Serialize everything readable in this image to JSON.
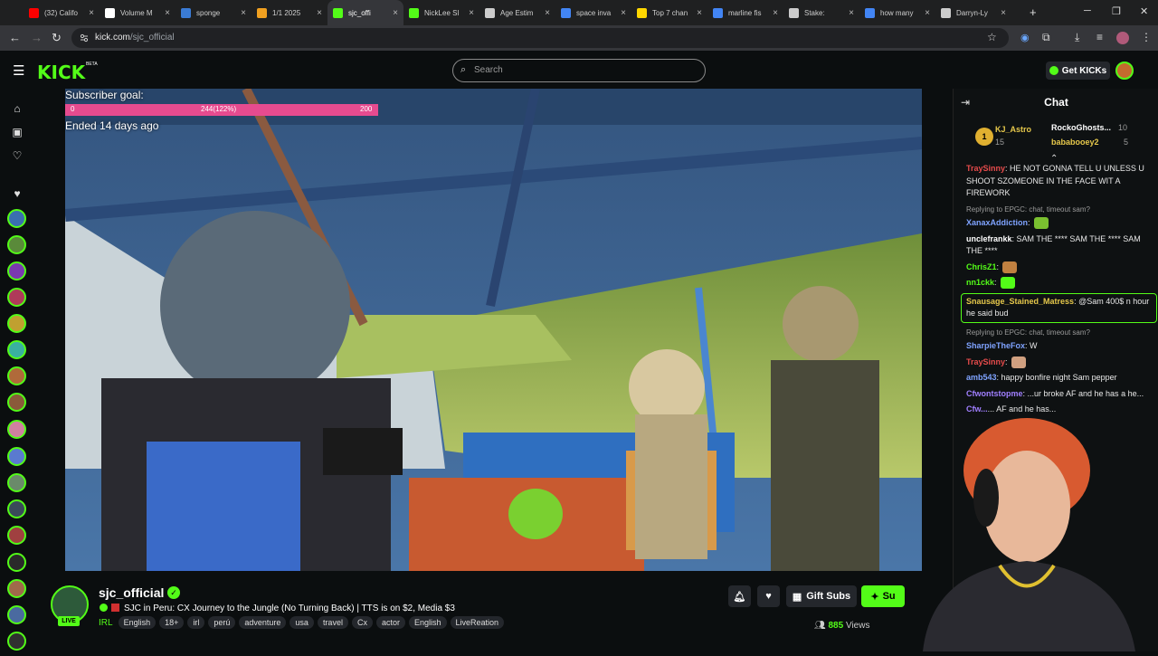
{
  "browser": {
    "tabs": [
      {
        "label": "(32) Califo",
        "color": "#ff0000"
      },
      {
        "label": "Volume M",
        "color": "#ffffff"
      },
      {
        "label": "sponge",
        "color": "#3a7bd5"
      },
      {
        "label": "1/1 2025",
        "color": "#f0a020"
      },
      {
        "label": "sjc_offi",
        "color": "#53fc18",
        "active": true
      },
      {
        "label": "NickLee Sl",
        "color": "#53fc18"
      },
      {
        "label": "Age Estim",
        "color": "#cccccc"
      },
      {
        "label": "space inva",
        "color": "#4285f4"
      },
      {
        "label": "Top 7 chan",
        "color": "#ffd700"
      },
      {
        "label": "marline fis",
        "color": "#4285f4"
      },
      {
        "label": "Stake:",
        "color": "#cccccc"
      },
      {
        "label": "how many",
        "color": "#4285f4"
      },
      {
        "label": "Darryn-Ly",
        "color": "#cccccc"
      }
    ],
    "url_host": "kick.com",
    "url_path": "/sjc_official",
    "new_tab": "+",
    "window_min": "─",
    "window_max": "❐",
    "window_close": "✕"
  },
  "header": {
    "logo": "KICK",
    "beta": "BETA",
    "search_placeholder": "Search",
    "get_kicks": "Get KICKs"
  },
  "goal": {
    "label": "Subscriber goal:",
    "start": "0",
    "progress": "244(122%)",
    "target": "200",
    "fraction": 1.0,
    "ended": "Ended 14 days ago"
  },
  "channel": {
    "name": "sjc_official",
    "live": "LIVE",
    "title": "SJC in Peru: CX Journey to the Jungle (No Turning Back) | TTS is on $2, Media $3",
    "category": "IRL",
    "tags": [
      "English",
      "18+",
      "irl",
      "perú",
      "adventure",
      "usa",
      "travel",
      "Cx",
      "actor",
      "English",
      "LiveReation"
    ],
    "gift_subs": "Gift Subs",
    "subscribe": "Su",
    "viewers_count": "885",
    "viewers_label": "Views"
  },
  "chat": {
    "title": "Chat",
    "leaderboard": [
      {
        "rank": "1",
        "name": "KJ_Astro",
        "score": "15"
      },
      {
        "name": "RockoGhosts...",
        "score": "10"
      },
      {
        "name": "bababooey2",
        "score": "5"
      }
    ],
    "messages": [
      {
        "user": "TraySinny",
        "color": "#e64b4b",
        "text": ": HE NOT GONNA TELL U UNLESS U SHOOT SZOMEONE IN THE FACE WIT A FIREWORK"
      },
      {
        "reply": "Replying to EPGC: chat, timeout sam?"
      },
      {
        "user": "XanaxAddiction",
        "color": "#7fa3ff",
        "text": ":"
      },
      {
        "user": "unclefrankk",
        "color": "#ffffff",
        "text": ": SAM THE **** SAM THE **** SAM THE ****"
      },
      {
        "user": "ChrisZ1",
        "color": "#53fc18",
        "text": ":"
      },
      {
        "user": "nn1ckk",
        "color": "#53fc18",
        "text": ":"
      },
      {
        "user": "Snausage_Stained_Matress",
        "color": "#e6c84b",
        "text": ": @Sam 400$ n hour he said bud",
        "highlight": true
      },
      {
        "reply": "Replying to EPGC: chat, timeout sam?"
      },
      {
        "user": "SharpieTheFox",
        "color": "#7fa3ff",
        "text": ": W"
      },
      {
        "user": "TraySinny",
        "color": "#e64b4b",
        "text": ":"
      },
      {
        "user": "amb543",
        "color": "#7fa3ff",
        "text": ": happy bonfire night Sam pepper"
      },
      {
        "user": "Cfwontstopme",
        "color": "#a07fff",
        "text": ": ...ur broke AF and he has a he..."
      },
      {
        "user": "Cfw...",
        "color": "#a07fff",
        "text": "... AF and he has..."
      }
    ]
  }
}
